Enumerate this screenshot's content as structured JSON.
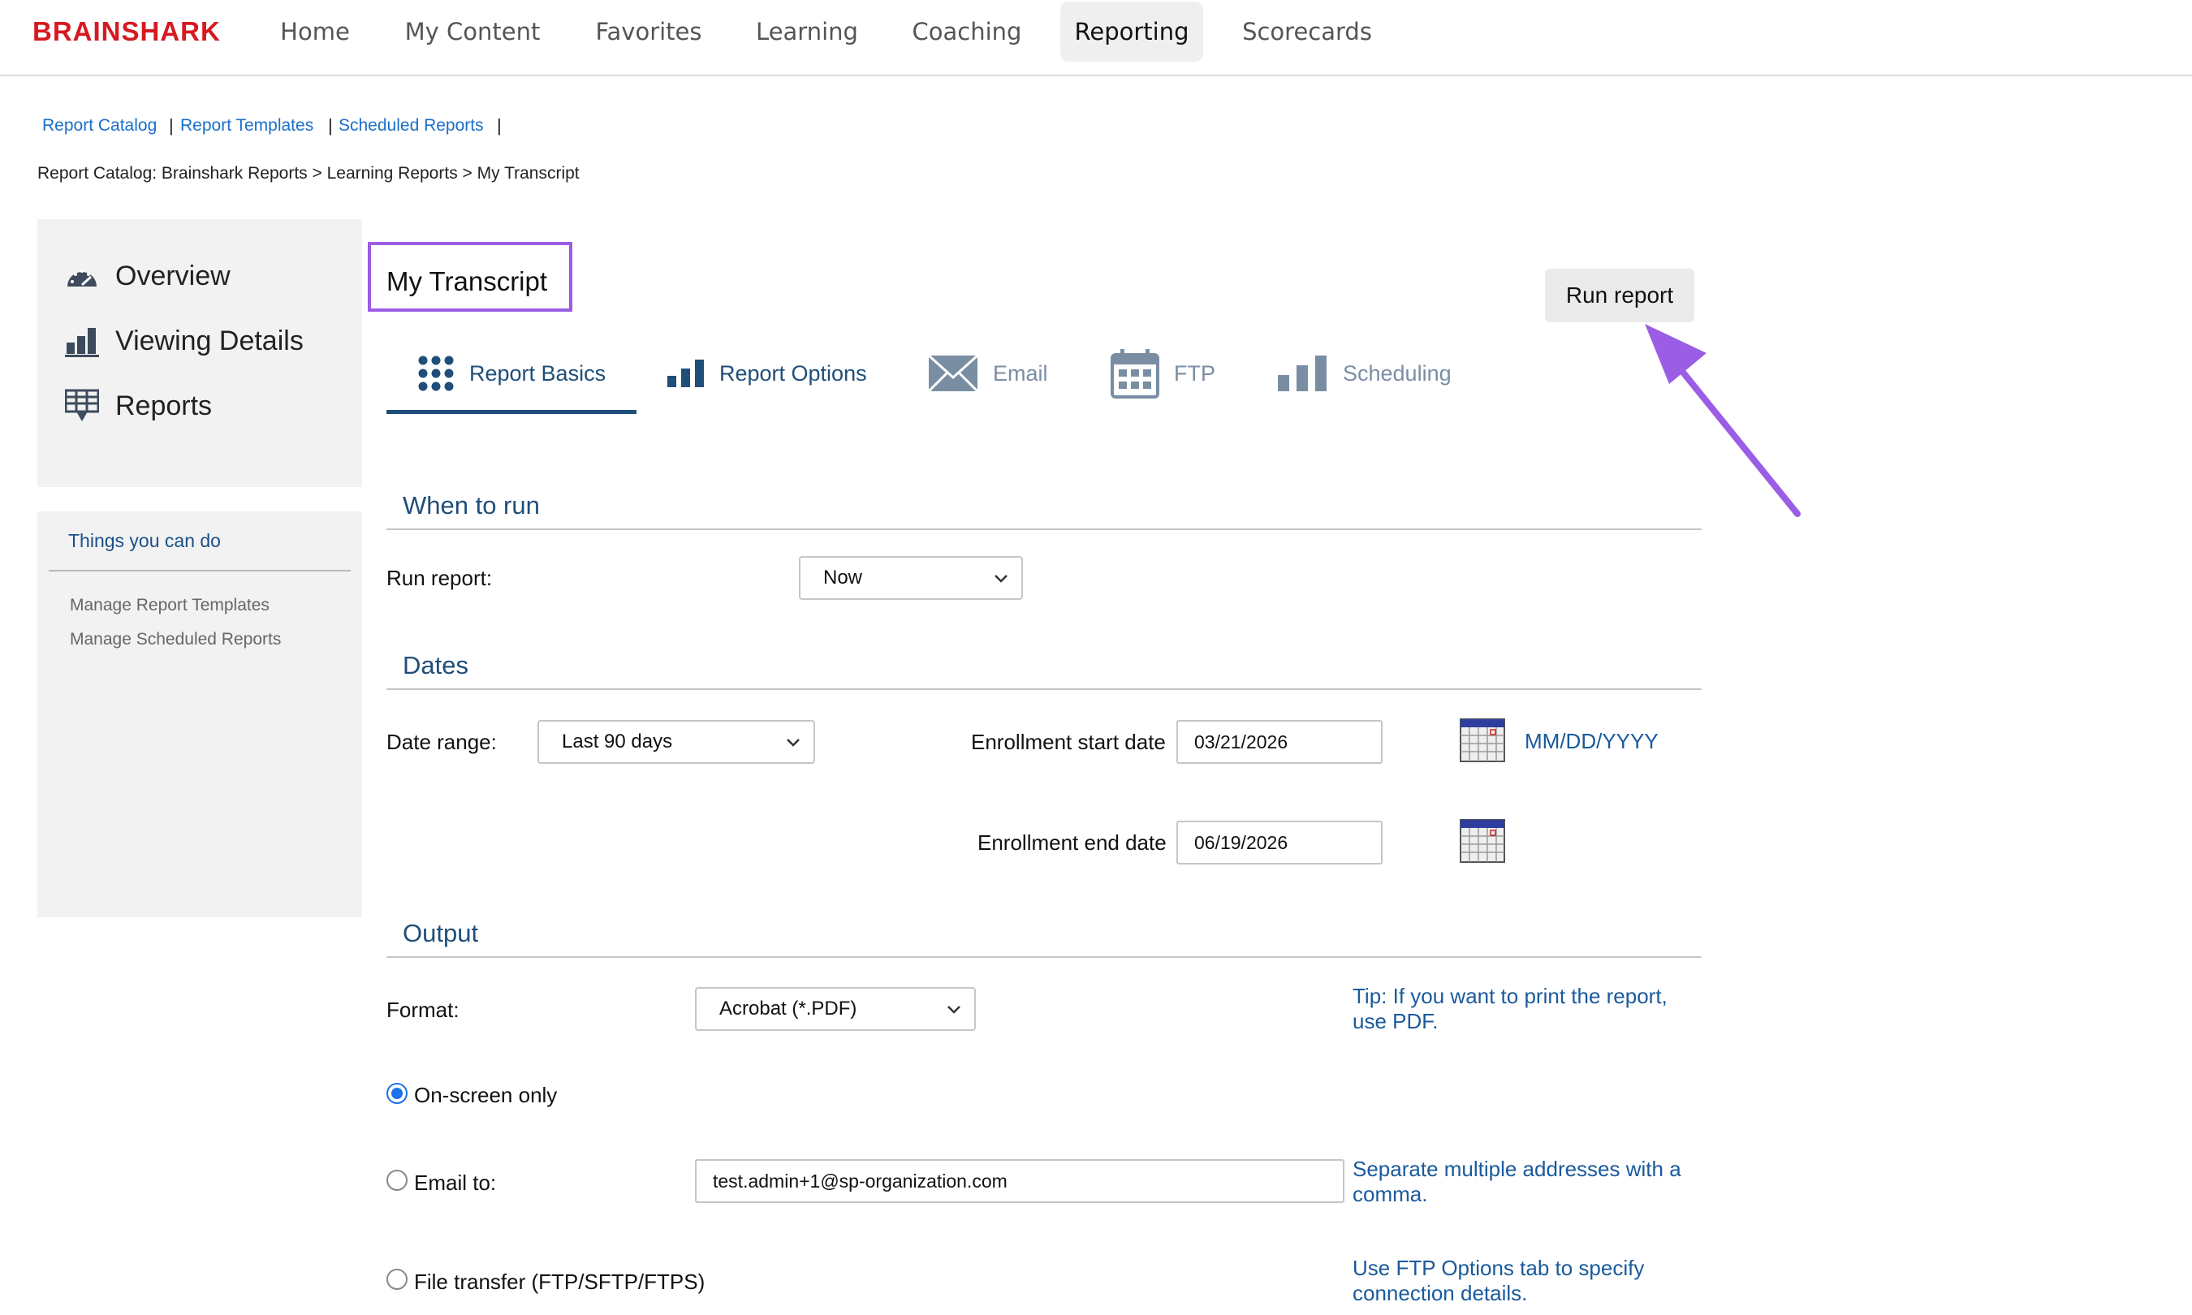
{
  "app": {
    "logo": "BRAINSHARK"
  },
  "nav": {
    "items": [
      "Home",
      "My Content",
      "Favorites",
      "Learning",
      "Coaching",
      "Reporting",
      "Scorecards"
    ],
    "active": "Reporting"
  },
  "sublinks": [
    "Report Catalog",
    "Report Templates",
    "Scheduled Reports"
  ],
  "breadcrumb": "Report Catalog: Brainshark Reports > Learning Reports > My Transcript",
  "sidebar": {
    "items": [
      {
        "label": "Overview",
        "icon": "speedometer-icon"
      },
      {
        "label": "Viewing Details",
        "icon": "bar-chart-icon"
      },
      {
        "label": "Reports",
        "icon": "report-download-icon"
      }
    ],
    "things_title": "Things you can do",
    "links": [
      "Manage Report Templates",
      "Manage Scheduled Reports"
    ]
  },
  "page": {
    "title": "My Transcript",
    "run_button": "Run report"
  },
  "tabs": [
    {
      "label": "Report Basics",
      "icon": "grid-dots-icon",
      "active": true
    },
    {
      "label": "Report Options",
      "icon": "bar-chart-icon",
      "active": false
    },
    {
      "label": "Email",
      "icon": "envelope-icon",
      "active": false,
      "disabled": true
    },
    {
      "label": "FTP",
      "icon": "calendar-grid-icon",
      "active": false,
      "disabled": true
    },
    {
      "label": "Scheduling",
      "icon": "bar-chart-icon",
      "active": false,
      "disabled": true
    }
  ],
  "when_to_run": {
    "title": "When to run",
    "run_label": "Run report:",
    "run_value": "Now"
  },
  "dates": {
    "title": "Dates",
    "range_label": "Date range:",
    "range_value": "Last 90 days",
    "start_label": "Enrollment start date",
    "start_value": "03/21/2026",
    "end_label": "Enrollment end date",
    "end_value": "06/19/2026",
    "format_hint": "MM/DD/YYYY"
  },
  "output": {
    "title": "Output",
    "format_label": "Format:",
    "format_value": "Acrobat (*.PDF)",
    "format_tip_1": "Tip: If you want to print the report,",
    "format_tip_2": "use PDF.",
    "onscreen_label": "On-screen only",
    "onscreen_selected": true,
    "email_label": "Email to:",
    "email_value": "test.admin+1@sp-organization.com",
    "email_hint_1": "Separate multiple addresses with a",
    "email_hint_2": "comma.",
    "ftp_label": "File transfer (FTP/SFTP/FTPS)",
    "ftp_hint_1": "Use FTP Options tab to specify",
    "ftp_hint_2": "connection details."
  },
  "colors": {
    "brand": "#d71920",
    "link": "#1a6fc9",
    "section": "#1f4e79",
    "highlight": "#9b5de5"
  }
}
